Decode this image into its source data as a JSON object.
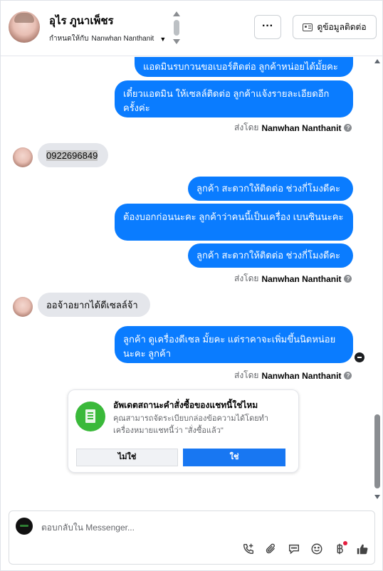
{
  "header": {
    "contact_name": "อุไร ภูนาเพ็ชร",
    "assigned_label": "กำหนดให้กับ",
    "assigned_to": "Nanwhan Nanthanit",
    "more_label": "···",
    "contact_info_label": "ดูข้อมูลติดต่อ"
  },
  "messages": {
    "m1": "แอดมินรบกวนขอเบอร์ติดต่อ ลูกค้าหน่อยได้มั้ยคะ",
    "m2": "เดี๋ยวแอดมิน ให้เซลล์ติดต่อ ลูกค้าแจ้งรายละเอียดอีกครั้งค่ะ",
    "phone": "0922696849",
    "m3": "ลูกค้า สะดวกให้ติดต่อ ช่วงกี่โมงดีคะ",
    "m4": "ต้องบอกก่อนนะคะ ลูกค้าว่าคนนี้เป็นเครื่อง เบนซินนะคะ",
    "m5": "ลูกค้า สะดวกให้ติดต่อ ช่วงกี่โมงดีคะ",
    "in2": "ออจ้าอยากได้ดีเซลล์จ้า",
    "m6": "ลูกค้า ดูเครื่องดีเซล มั้ยคะ แต่ราคาจะเพิ่มขึ้นนิดหน่อยนะคะ ลูกค้า"
  },
  "sent_by": {
    "prefix": "ส่งโดย",
    "name": "Nanwhan Nanthanit",
    "help": "?"
  },
  "order_card": {
    "title": "อัพเดตสถานะคำสั่งซื้อของแชทนี้ใช่ไหม",
    "description": "คุณสามารถจัดระเบียบกล่องข้อความได้โดยทำเครื่องหมายแชทนี้ว่า \"สั่งซื้อแล้ว\"",
    "no_label": "ไม่ใช่",
    "yes_label": "ใช่"
  },
  "composer": {
    "placeholder": "ตอบกลับใน Messenger...",
    "tools": [
      "call-add-icon",
      "attachment-icon",
      "saved-reply-icon",
      "emoji-icon",
      "baht-payment-icon",
      "thumbs-up-icon"
    ]
  },
  "colors": {
    "outgoing_bubble": "#0a7cff",
    "incoming_bubble": "#e4e6eb",
    "yes_button": "#1877f2",
    "order_icon": "#3ab93a",
    "notification_dot": "#e41e3f"
  }
}
